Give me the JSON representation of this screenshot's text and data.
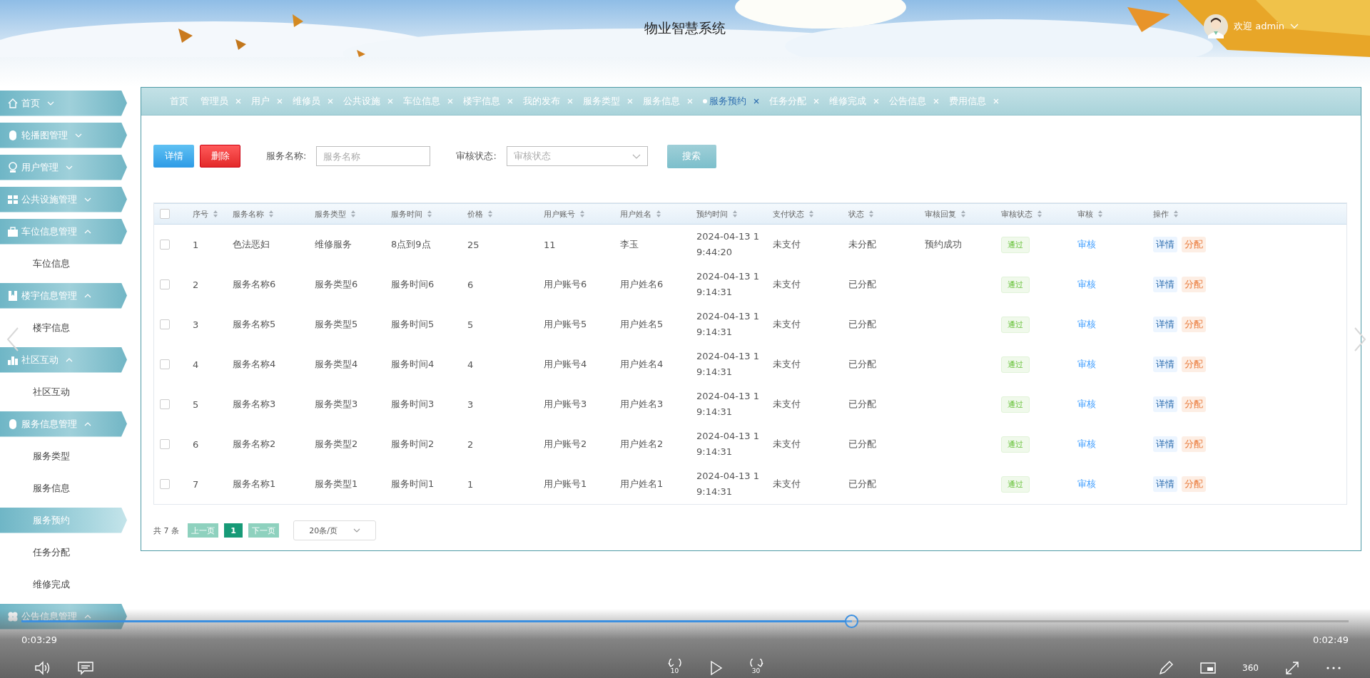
{
  "header": {
    "title": "物业智慧系统",
    "greeting": "欢迎 admin"
  },
  "sidebar": {
    "items": [
      {
        "label": "首页",
        "expanded": false
      },
      {
        "label": "轮播图管理",
        "expanded": false
      },
      {
        "label": "用户管理",
        "expanded": false
      },
      {
        "label": "公共设施管理",
        "expanded": false
      },
      {
        "label": "车位信息管理",
        "expanded": true,
        "children": [
          {
            "label": "车位信息",
            "selected": false
          }
        ]
      },
      {
        "label": "楼宇信息管理",
        "expanded": true,
        "children": [
          {
            "label": "楼宇信息",
            "selected": false
          }
        ]
      },
      {
        "label": "社区互动",
        "expanded": true,
        "children": [
          {
            "label": "社区互动",
            "selected": false
          }
        ]
      },
      {
        "label": "服务信息管理",
        "expanded": true,
        "children": [
          {
            "label": "服务类型",
            "selected": false
          },
          {
            "label": "服务信息",
            "selected": false
          },
          {
            "label": "服务预约",
            "selected": true
          },
          {
            "label": "任务分配",
            "selected": false
          },
          {
            "label": "维修完成",
            "selected": false
          }
        ]
      },
      {
        "label": "公告信息管理",
        "expanded": true
      }
    ]
  },
  "tabs": [
    {
      "label": "首页",
      "closable": false,
      "selected": false
    },
    {
      "label": "管理员",
      "closable": true,
      "selected": false
    },
    {
      "label": "用户",
      "closable": true,
      "selected": false
    },
    {
      "label": "维修员",
      "closable": true,
      "selected": false
    },
    {
      "label": "公共设施",
      "closable": true,
      "selected": false
    },
    {
      "label": "车位信息",
      "closable": true,
      "selected": false
    },
    {
      "label": "楼宇信息",
      "closable": true,
      "selected": false
    },
    {
      "label": "我的发布",
      "closable": true,
      "selected": false
    },
    {
      "label": "服务类型",
      "closable": true,
      "selected": false
    },
    {
      "label": "服务信息",
      "closable": true,
      "selected": false
    },
    {
      "label": "服务预约",
      "closable": true,
      "selected": true
    },
    {
      "label": "任务分配",
      "closable": true,
      "selected": false
    },
    {
      "label": "维修完成",
      "closable": true,
      "selected": false
    },
    {
      "label": "公告信息",
      "closable": true,
      "selected": false
    },
    {
      "label": "费用信息",
      "closable": true,
      "selected": false
    }
  ],
  "toolbar": {
    "buttons": [
      {
        "label": "详情",
        "kind": "primary"
      },
      {
        "label": "删除",
        "kind": "danger"
      }
    ],
    "filters": [
      {
        "label": "服务名称:",
        "placeholder": "服务名称",
        "kind": "text"
      },
      {
        "label": "审核状态:",
        "placeholder": "审核状态",
        "kind": "select"
      }
    ],
    "search_button": "搜索"
  },
  "table": {
    "select_all": false,
    "columns": [
      "序号",
      "服务名称",
      "服务类型",
      "服务时间",
      "价格",
      "用户账号",
      "用户姓名",
      "预约时间",
      "支付状态",
      "状态",
      "审核回复",
      "审核状态",
      "审核",
      "操作"
    ],
    "rows": [
      {
        "checked": false,
        "no": "1",
        "name": "色法恶妇",
        "type": "维修服务",
        "time": "8点到9点",
        "price": "25",
        "account": "11",
        "user": "李玉",
        "booked_at": "2024-04-13 19:44:20",
        "pay": "未支付",
        "status": "未分配",
        "reply": "预约成功",
        "review": "通过",
        "audit": "审核",
        "actions": [
          "详情",
          "分配"
        ]
      },
      {
        "checked": false,
        "no": "2",
        "name": "服务名称6",
        "type": "服务类型6",
        "time": "服务时间6",
        "price": "6",
        "account": "用户账号6",
        "user": "用户姓名6",
        "booked_at": "2024-04-13 19:14:31",
        "pay": "未支付",
        "status": "已分配",
        "review": "通过",
        "audit": "审核",
        "actions": [
          "详情",
          "分配"
        ]
      },
      {
        "checked": false,
        "no": "3",
        "name": "服务名称5",
        "type": "服务类型5",
        "time": "服务时间5",
        "price": "5",
        "account": "用户账号5",
        "user": "用户姓名5",
        "booked_at": "2024-04-13 19:14:31",
        "pay": "未支付",
        "status": "已分配",
        "review": "通过",
        "audit": "审核",
        "actions": [
          "详情",
          "分配"
        ]
      },
      {
        "checked": false,
        "no": "4",
        "name": "服务名称4",
        "type": "服务类型4",
        "time": "服务时间4",
        "price": "4",
        "account": "用户账号4",
        "user": "用户姓名4",
        "booked_at": "2024-04-13 19:14:31",
        "pay": "未支付",
        "status": "已分配",
        "review": "通过",
        "audit": "审核",
        "actions": [
          "详情",
          "分配"
        ]
      },
      {
        "checked": false,
        "no": "5",
        "name": "服务名称3",
        "type": "服务类型3",
        "time": "服务时间3",
        "price": "3",
        "account": "用户账号3",
        "user": "用户姓名3",
        "booked_at": "2024-04-13 19:14:31",
        "pay": "未支付",
        "status": "已分配",
        "review": "通过",
        "audit": "审核",
        "actions": [
          "详情",
          "分配"
        ]
      },
      {
        "checked": false,
        "no": "6",
        "name": "服务名称2",
        "type": "服务类型2",
        "time": "服务时间2",
        "price": "2",
        "account": "用户账号2",
        "user": "用户姓名2",
        "booked_at": "2024-04-13 19:14:31",
        "pay": "未支付",
        "status": "已分配",
        "review": "通过",
        "audit": "审核",
        "actions": [
          "详情",
          "分配"
        ]
      },
      {
        "checked": false,
        "no": "7",
        "name": "服务名称1",
        "type": "服务类型1",
        "time": "服务时间1",
        "price": "1",
        "account": "用户账号1",
        "user": "用户姓名1",
        "booked_at": "2024-04-13 19:14:31",
        "pay": "未支付",
        "status": "已分配",
        "review": "通过",
        "audit": "审核",
        "actions": [
          "详情",
          "分配"
        ]
      }
    ]
  },
  "pagination": {
    "total": "共 7 条",
    "prev": "上一页",
    "pages": [
      {
        "label": "1",
        "selected": true
      }
    ],
    "next": "下一页",
    "page_size": "20条/页"
  },
  "player": {
    "elapsed": "0:03:29",
    "remaining": "0:02:49",
    "level": 0.626,
    "skip_back": "10",
    "skip_forward": "30",
    "view_360": "360"
  }
}
